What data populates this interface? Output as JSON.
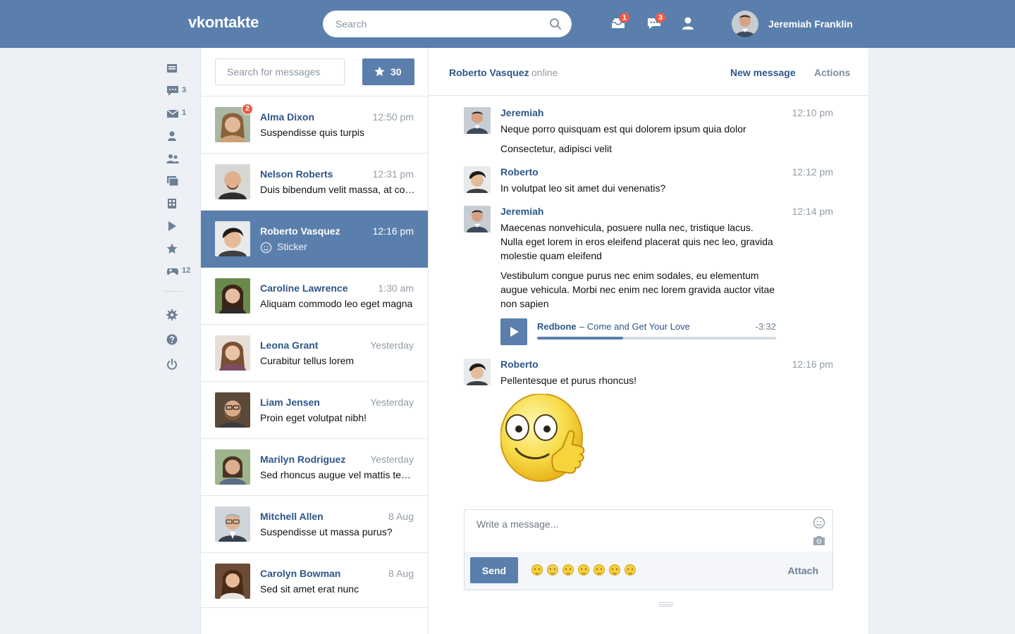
{
  "header": {
    "logo": "vkontakte",
    "search_placeholder": "Search",
    "icons": [
      {
        "name": "inbox-tray-icon",
        "badge": "1"
      },
      {
        "name": "messages-icon",
        "badge": "3"
      },
      {
        "name": "person-icon",
        "badge": ""
      }
    ],
    "user_name": "Jeremiah Franklin"
  },
  "left_nav": [
    {
      "name": "news-icon",
      "count": ""
    },
    {
      "name": "messages-icon",
      "count": "3"
    },
    {
      "name": "mail-icon",
      "count": "1"
    },
    {
      "name": "friends-icon",
      "count": ""
    },
    {
      "name": "groups-icon",
      "count": ""
    },
    {
      "name": "photos-icon",
      "count": ""
    },
    {
      "name": "apps-grid-icon",
      "count": ""
    },
    {
      "name": "video-play-icon",
      "count": ""
    },
    {
      "name": "favorites-star-icon",
      "count": ""
    },
    {
      "name": "games-icon",
      "count": "12"
    },
    {
      "name": "settings-gear-icon",
      "count": ""
    },
    {
      "name": "help-icon",
      "count": ""
    },
    {
      "name": "power-icon",
      "count": ""
    }
  ],
  "conversations": {
    "search_placeholder": "Search for messages",
    "starred_count": "30",
    "items": [
      {
        "name": "Alma Dixon",
        "time": "12:50 pm",
        "preview": "Suspendisse quis turpis",
        "badge": "2",
        "active": false
      },
      {
        "name": "Nelson Roberts",
        "time": "12:31 pm",
        "preview": "Duis bibendum velit massa, at congue",
        "badge": "",
        "active": false
      },
      {
        "name": "Roberto Vasquez",
        "time": "12:16 pm",
        "preview": "Sticker",
        "badge": "",
        "active": true
      },
      {
        "name": "Caroline Lawrence",
        "time": "1:30 am",
        "preview": "Aliquam commodo leo eget magna",
        "badge": "",
        "active": false
      },
      {
        "name": "Leona Grant",
        "time": "Yesterday",
        "preview": "Curabitur tellus lorem",
        "badge": "",
        "active": false
      },
      {
        "name": "Liam Jensen",
        "time": "Yesterday",
        "preview": "Proin eget volutpat nibh!",
        "badge": "",
        "active": false
      },
      {
        "name": "Marilyn Rodriguez",
        "time": "Yesterday",
        "preview": "Sed rhoncus augue vel mattis tempor",
        "badge": "",
        "active": false
      },
      {
        "name": "Mitchell Allen",
        "time": "8 Aug",
        "preview": "Suspendisse ut massa purus?",
        "badge": "",
        "active": false
      },
      {
        "name": "Carolyn Bowman",
        "time": "8 Aug",
        "preview": "Sed sit amet erat nunc",
        "badge": "",
        "active": false
      }
    ]
  },
  "chat": {
    "contact_name": "Roberto Vasquez",
    "status": "online",
    "new_message_label": "New message",
    "actions_label": "Actions",
    "messages": [
      {
        "author": "Jeremiah",
        "time": "12:10 pm",
        "lines": [
          "Neque porro quisquam est qui dolorem ipsum quia dolor",
          "Consectetur, adipisci velit"
        ]
      },
      {
        "author": "Roberto",
        "time": "12:12 pm",
        "lines": [
          "In volutpat leo sit amet dui venenatis?"
        ]
      },
      {
        "author": "Jeremiah",
        "time": "12:14 pm",
        "lines": [
          "Maecenas nonvehicula, posuere nulla nec, tristique lacus. Nulla eget lorem in eros eleifend placerat quis nec leo, gravida molestie quam eleifend",
          "Vestibulum congue purus nec enim sodales, eu elementum augue vehicula. Morbi nec enim nec lorem gravida auctor vitae non sapien"
        ]
      },
      {
        "author": "Roberto",
        "time": "12:16 pm",
        "lines": [
          "Pellentesque et purus rhoncus!"
        ]
      }
    ],
    "audio": {
      "artist": "Redbone",
      "separator": "–",
      "title": "Come and Get Your Love",
      "remaining": "-3:32",
      "progress": 0.36
    },
    "composer": {
      "placeholder": "Write a message...",
      "send_label": "Send",
      "attach_label": "Attach",
      "emoji_count": 7
    }
  },
  "colors": {
    "brand": "#5a7fad",
    "badge": "#ec5c48",
    "link": "#2e5689"
  }
}
